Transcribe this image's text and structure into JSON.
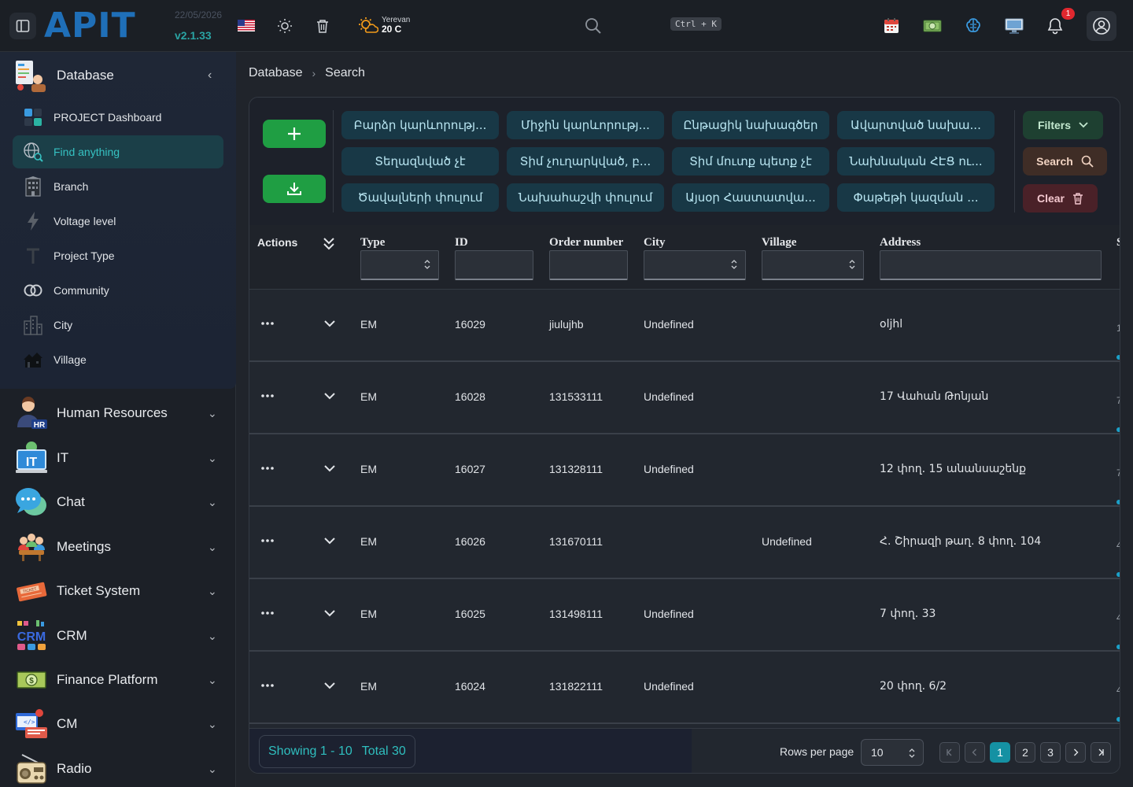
{
  "app": {
    "logo": "APIT",
    "date": "22/05/2026",
    "version": "v2.1.33"
  },
  "topbar": {
    "weather_city": "Yerevan",
    "weather_temp": "20 C",
    "shortcut": "Ctrl + K",
    "notification_count": "1"
  },
  "sidebar": {
    "database": {
      "label": "Database",
      "items": [
        {
          "label": "PROJECT Dashboard",
          "icon": "dashboard-icon"
        },
        {
          "label": "Find anything",
          "icon": "search-globe-icon",
          "active": true
        },
        {
          "label": "Branch",
          "icon": "building-icon"
        },
        {
          "label": "Voltage level",
          "icon": "lightning-icon"
        },
        {
          "label": "Project Type",
          "icon": "type-icon"
        },
        {
          "label": "Community",
          "icon": "rings-icon"
        },
        {
          "label": "City",
          "icon": "city-icon"
        },
        {
          "label": "Village",
          "icon": "village-icon"
        }
      ]
    },
    "groups": [
      {
        "label": "Human Resources",
        "icon": "hr-icon"
      },
      {
        "label": "IT",
        "icon": "it-icon"
      },
      {
        "label": "Chat",
        "icon": "chat-icon"
      },
      {
        "label": "Meetings",
        "icon": "meetings-icon"
      },
      {
        "label": "Ticket System",
        "icon": "ticket-icon"
      },
      {
        "label": "CRM",
        "icon": "crm-icon"
      },
      {
        "label": "Finance Platform",
        "icon": "finance-icon"
      },
      {
        "label": "CM",
        "icon": "cm-icon"
      },
      {
        "label": "Radio",
        "icon": "radio-icon"
      }
    ]
  },
  "breadcrumb": {
    "root": "Database",
    "current": "Search"
  },
  "chips": [
    "Բարձր կարևորությ...",
    "Միջին կարևորությ...",
    "Ընթացիկ նախագծեր",
    "Ավարտված նախա...",
    "Տեղազնված չէ",
    "Տիմ չուղարկված, բ...",
    "Տիմ մուտք պետք չէ",
    "Նախնական ՀԷՑ ու...",
    "Ծավալների փուլում",
    "Նախահաշվի փուլում",
    "Այսօր Հաստատվա...",
    "Փաթեթի կազման ..."
  ],
  "buttons": {
    "filters": "Filters",
    "search": "Search",
    "clear": "Clear"
  },
  "table": {
    "actions_header": "Actions",
    "columns": [
      "Type",
      "ID",
      "Order number",
      "City",
      "Village",
      "Address"
    ],
    "edge_header": "S",
    "rows": [
      {
        "type": "EM",
        "id": "16029",
        "order": "jiulujhb",
        "city": "Undefined",
        "village": "",
        "address": "oljhl",
        "edge": "1"
      },
      {
        "type": "EM",
        "id": "16028",
        "order": "131533111",
        "city": "Undefined",
        "village": "",
        "address": "17 Վահան Թոնյան",
        "edge": "7"
      },
      {
        "type": "EM",
        "id": "16027",
        "order": "131328111",
        "city": "Undefined",
        "village": "",
        "address": "12 փող. 15 անանսաշենք",
        "edge": "7"
      },
      {
        "type": "EM",
        "id": "16026",
        "order": "131670111",
        "city": "",
        "village": "Undefined",
        "address": "Հ. Շիրազի թաղ. 8 փող. 104",
        "edge": "4"
      },
      {
        "type": "EM",
        "id": "16025",
        "order": "131498111",
        "city": "Undefined",
        "village": "",
        "address": "7 փող. 33",
        "edge": "4"
      },
      {
        "type": "EM",
        "id": "16024",
        "order": "131822111",
        "city": "Undefined",
        "village": "",
        "address": "20 փող. 6/2",
        "edge": "4"
      }
    ]
  },
  "footer": {
    "showing": "Showing 1 - 10",
    "total": "Total 30",
    "rows_per_page_label": "Rows per page",
    "rows_per_page": "10",
    "pages": [
      "1",
      "2",
      "3"
    ],
    "current_page": "1"
  }
}
